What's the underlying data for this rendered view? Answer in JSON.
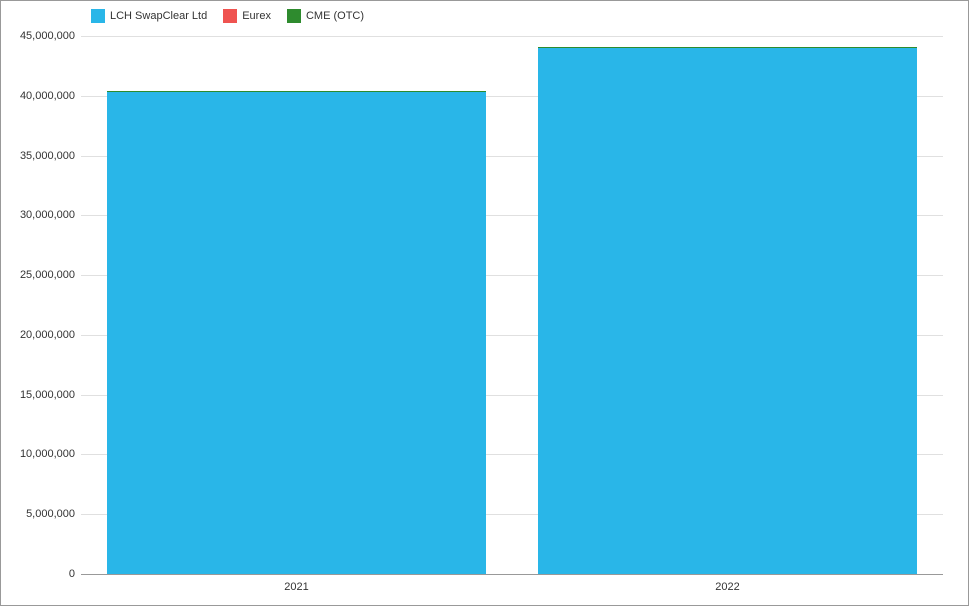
{
  "chart_data": {
    "type": "bar",
    "stacked": true,
    "categories": [
      "2021",
      "2022"
    ],
    "series": [
      {
        "name": "LCH SwapClear Ltd",
        "color": "#29b6e8",
        "values": [
          42600000,
          44500000
        ]
      },
      {
        "name": "Eurex",
        "color": "#ef5350",
        "values": [
          80000,
          80000
        ]
      },
      {
        "name": "CME (OTC)",
        "color": "#2e8b2e",
        "values": [
          20000,
          20000
        ]
      }
    ],
    "xlabel": "",
    "ylabel": "",
    "ylim": [
      0,
      45000000
    ],
    "y_ticks": [
      0,
      5000000,
      10000000,
      15000000,
      20000000,
      25000000,
      30000000,
      35000000,
      40000000,
      45000000
    ],
    "y_tick_labels": [
      "0",
      "5,000,000",
      "10,000,000",
      "15,000,000",
      "20,000,000",
      "25,000,000",
      "30,000,000",
      "35,000,000",
      "40,000,000",
      "45,000,000"
    ]
  }
}
